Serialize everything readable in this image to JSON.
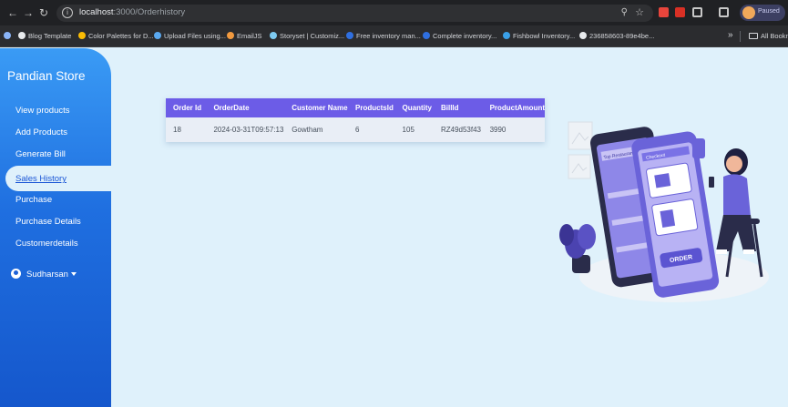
{
  "browser": {
    "url_host": "localhost",
    "url_path": ":3000/Orderhistory",
    "profile_label": "Paused",
    "bookmarks": [
      {
        "label": "Blog Template",
        "color": "#e8eaed"
      },
      {
        "label": "Color Palettes for D...",
        "color": "#fbbc04"
      },
      {
        "label": "Upload Files using...",
        "color": "#5aa9f0"
      },
      {
        "label": "EmailJS",
        "color": "#f29a3f"
      },
      {
        "label": "Storyset | Customiz...",
        "color": "#7ecbf2"
      },
      {
        "label": "Free inventory man...",
        "color": "#2f6fe0"
      },
      {
        "label": "Complete inventory...",
        "color": "#2f6fe0"
      },
      {
        "label": "Fishbowl Inventory...",
        "color": "#3aa0e8"
      },
      {
        "label": "236858603-89e4be...",
        "color": "#e8eaed"
      }
    ],
    "all_bookmarks": "All Bookmarks"
  },
  "sidebar": {
    "brand": "Pandian Store",
    "items": [
      {
        "label": "View products"
      },
      {
        "label": "Add Products"
      },
      {
        "label": "Generate Bill"
      },
      {
        "label": "Sales History"
      },
      {
        "label": "Purchase"
      },
      {
        "label": "Purchase Details"
      },
      {
        "label": "Customerdetails"
      }
    ],
    "user": "Sudharsan"
  },
  "orders": {
    "headers": [
      "Order Id",
      "OrderDate",
      "Customer Name",
      "ProductsId",
      "Quantity",
      "BillId",
      "ProductAmount"
    ],
    "rows": [
      [
        "18",
        "2024-03-31T09:57:13",
        "Gowtham",
        "6",
        "105",
        "RZ49d53f43",
        "3990"
      ]
    ]
  },
  "illustration": {
    "screen_labels": [
      "Top Restaurants",
      "Checkout",
      "ORDER"
    ]
  }
}
